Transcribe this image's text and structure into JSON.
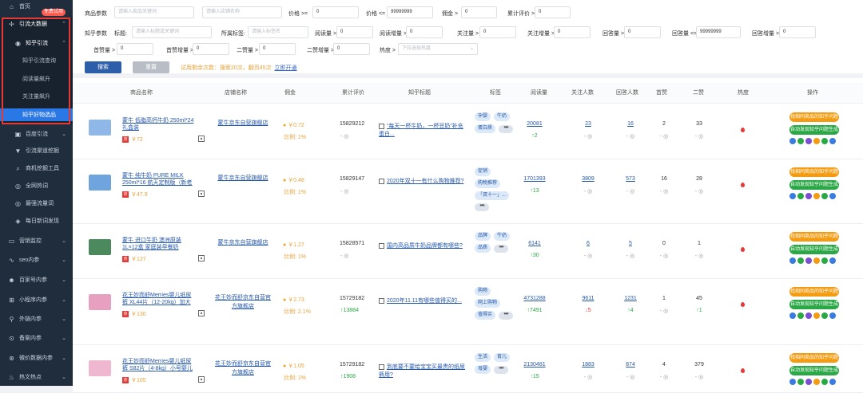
{
  "sidebar": {
    "home": "首页",
    "group": "引流大数据",
    "badge": "免费试用",
    "section": "知乎引流",
    "subs": [
      "知乎引流查询",
      "阅读量飙升",
      "关注量飙升",
      "知乎好物选品"
    ],
    "items": [
      "百度引流",
      "引流渠道挖掘",
      "商机挖掘工具",
      "全网热词",
      "最强流量词",
      "每日新词发现",
      "营销监控",
      "seo内参",
      "百家号内参",
      "小程序内参",
      "外链内参",
      "备案内参",
      "微价数据内参",
      "热文热点"
    ]
  },
  "filters": {
    "row1": {
      "product_label": "商品参数",
      "product_ph": "请输入商品关键词",
      "shop_ph": "请输入店铺名称",
      "price_min_label": "价格 >=",
      "price_min": "0",
      "price_max_label": "价格 <=",
      "price_max": "99999999",
      "commission_label": "佣金 >",
      "commission": "0",
      "cum_label": "累计评价 >",
      "cum": "0"
    },
    "row2": {
      "zhihu_label": "知乎参数",
      "title_label": "标题:",
      "title_ph": "请输入标题或关键词",
      "tag_label": "所属标签:",
      "tag_ph": "请输入标签名",
      "read_label": "阅读量 >",
      "read": "0",
      "read_inc_label": "阅读增量 >",
      "read_inc": "0",
      "follow_label": "关注量 >",
      "follow": "0",
      "follow_inc_label": "关注增量 >",
      "follow_inc": "0",
      "answer_label": "回答量 >",
      "answer": "0",
      "answer_le_label": "回答量 <=",
      "answer_le": "99999999",
      "answer_inc_label": "回答增量 >",
      "answer_inc": "0"
    },
    "row3": {
      "first_label": "首赞量 >",
      "first": "0",
      "first_inc_label": "首赞增量 >",
      "first_inc": "0",
      "second_label": "二赞量 >",
      "second": "0",
      "second_inc_label": "二赞增量 >",
      "second_inc": "0",
      "sort_label": "热度 >",
      "sort_value": "下拉选择热度"
    },
    "search_btn": "搜索",
    "reset_btn": "重置",
    "hint": "试用剩余次数：搜索20次，翻页45次",
    "hint_link": "立即开通"
  },
  "table": {
    "headers": [
      "商品名称",
      "店铺名称",
      "佣金",
      "累计评价",
      "知乎标题",
      "标签",
      "阅读量",
      "关注人数",
      "回答人数",
      "首赞",
      "二赞",
      "热度",
      "操作"
    ],
    "op1": "找相同商品的知乎问题",
    "op2": "自动发现知乎问题生成",
    "rows": [
      {
        "name": "蒙牛 低脂高钙牛奶 250ml*24 礼盒装",
        "price": "￥72",
        "shop": "蒙牛京东自营旗舰店",
        "commission": "￥0.72",
        "ratio": "比例: 1%",
        "cum": "15829212",
        "cum_delta": "- ◎",
        "title": "“每天一杯牛奶，一杯豆奶”补充蛋白...",
        "tags": [
          "孕婴",
          "牛奶",
          "蛋白质"
        ],
        "read": "20081",
        "read_d": "↑2",
        "follow": "23",
        "follow_d": "- ◎",
        "answer": "16",
        "answer_d": "- ◎",
        "first": "2",
        "first_d": "- ◎",
        "second": "33",
        "second_d": "- ◎",
        "thumb_color": "#8fb8e8"
      },
      {
        "name": "蒙牛 纯牛奶 PURE MILK 250ml*16 航天定制版（新老包装随机发货）",
        "price": "￥47.9",
        "shop": "蒙牛京东自营旗舰店",
        "commission": "￥0.48",
        "ratio": "比例: 1%",
        "cum": "15829147",
        "cum_delta": "- ◎",
        "title": "2020年双十一有什么购物推荐?",
        "tags": [
          "促销",
          "购物推荐",
          "「双十一」..."
        ],
        "read": "1701393",
        "read_d": "↑13",
        "follow": "3809",
        "follow_d": "- ◎",
        "answer": "573",
        "answer_d": "- ◎",
        "first": "16",
        "first_d": "- ◎",
        "second": "28",
        "second_d": "- ◎",
        "thumb_color": "#6fa4de"
      },
      {
        "name": "蒙牛 进口牛奶 澳洲原装 1L×12盒 家庭装早餐奶",
        "price": "￥127",
        "shop": "蒙牛京东自营旗舰店",
        "commission": "￥1.27",
        "ratio": "比例: 1%",
        "cum": "15828571",
        "cum_delta": "- ◎",
        "title": "国内高品质牛奶品牌都有哪些?",
        "tags": [
          "品牌",
          "牛奶",
          "品质"
        ],
        "read": "6141",
        "read_d": "↑30",
        "follow": "6",
        "follow_d": "- ◎",
        "answer": "5",
        "answer_d": "- ◎",
        "first": "0",
        "first_d": "- ◎",
        "second": "1",
        "second_d": "- ◎",
        "thumb_color": "#4c8a5e"
      },
      {
        "name": "花王妙而舒Merries婴儿纸尿裤 XL44片（12-20kg）加大号尿不湿（...",
        "price": "￥130",
        "shop": "花王妙而舒京东自营官方旗舰店",
        "commission": "￥2.73",
        "ratio": "比例: 2.1%",
        "cum": "15729182",
        "cum_delta": "↑13884",
        "title": "2020年11.11有哪些值得买的...",
        "tags": [
          "购物",
          "网上购物",
          "值得买"
        ],
        "read": "4731288",
        "read_d": "↑7491",
        "follow": "9611",
        "follow_d": "↓5",
        "answer": "1231",
        "answer_d": "↑4",
        "first": "1",
        "first_d": "- ◎",
        "second": "45",
        "second_d": "↑1",
        "thumb_color": "#e8a0c0"
      },
      {
        "name": "花王妙而舒Merries婴儿纸尿裤 S82片（4-8kg）小号婴儿尿不湿（日...",
        "price": "￥105",
        "shop": "花王妙而舒京东自营官方旗舰店",
        "commission": "￥1.05",
        "ratio": "比例: 1%",
        "cum": "15729182",
        "cum_delta": "↑1908",
        "title": "到底要不要给宝宝买最贵的纸尿裤用?",
        "tags": [
          "生活",
          "育儿",
          "母婴"
        ],
        "read": "2130481",
        "read_d": "↑15",
        "follow": "1883",
        "follow_d": "- ◎",
        "answer": "874",
        "answer_d": "- ◎",
        "first": "4",
        "first_d": "- ◎",
        "second": "379",
        "second_d": "- ◎",
        "thumb_color": "#f0b8d0"
      }
    ]
  },
  "colors": {
    "sidebar_bg": "#1f2d3d",
    "active": "#2a78e6",
    "link": "#2557a8",
    "orange": "#f39c12",
    "green": "#2aa845",
    "highlight": "#e53935"
  }
}
